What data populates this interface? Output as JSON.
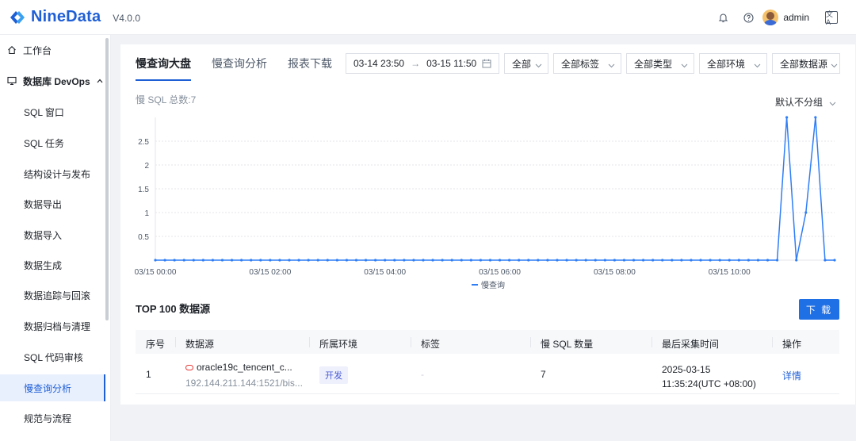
{
  "app": {
    "brand": "NineData",
    "version": "V4.0.0",
    "username": "admin",
    "lang_icon_text": "文A",
    "brand_color": "#1f5fd6"
  },
  "sidebar": {
    "items": [
      {
        "label": "工作台",
        "icon": "home-icon"
      },
      {
        "label": "数据库 DevOps",
        "icon": "monitor-icon",
        "expanded": true
      },
      {
        "label": "SQL 窗口"
      },
      {
        "label": "SQL 任务"
      },
      {
        "label": "结构设计与发布"
      },
      {
        "label": "数据导出"
      },
      {
        "label": "数据导入"
      },
      {
        "label": "数据生成"
      },
      {
        "label": "数据追踪与回滚"
      },
      {
        "label": "数据归档与清理"
      },
      {
        "label": "SQL 代码审核"
      },
      {
        "label": "慢查询分析",
        "active": true
      },
      {
        "label": "规范与流程"
      }
    ]
  },
  "tabs": [
    {
      "label": "慢查询大盘",
      "active": true
    },
    {
      "label": "慢查询分析"
    },
    {
      "label": "报表下载"
    }
  ],
  "filters": {
    "date_start": "03-14 23:50",
    "date_arrow": "→",
    "date_end": "03-15 11:50",
    "selects": [
      "全部",
      "全部标签",
      "全部类型",
      "全部环境",
      "全部数据源"
    ]
  },
  "summary": {
    "total_label": "慢 SQL 总数:7",
    "group_by": "默认不分组"
  },
  "chart_data": {
    "type": "line",
    "x": [
      "03/15 00:00",
      "03/15 00:10",
      "03/15 00:20",
      "03/15 00:30",
      "03/15 00:40",
      "03/15 00:50",
      "03/15 01:00",
      "03/15 01:10",
      "03/15 01:20",
      "03/15 01:30",
      "03/15 01:40",
      "03/15 01:50",
      "03/15 02:00",
      "03/15 02:10",
      "03/15 02:20",
      "03/15 02:30",
      "03/15 02:40",
      "03/15 02:50",
      "03/15 03:00",
      "03/15 03:10",
      "03/15 03:20",
      "03/15 03:30",
      "03/15 03:40",
      "03/15 03:50",
      "03/15 04:00",
      "03/15 04:10",
      "03/15 04:20",
      "03/15 04:30",
      "03/15 04:40",
      "03/15 04:50",
      "03/15 05:00",
      "03/15 05:10",
      "03/15 05:20",
      "03/15 05:30",
      "03/15 05:40",
      "03/15 05:50",
      "03/15 06:00",
      "03/15 06:10",
      "03/15 06:20",
      "03/15 06:30",
      "03/15 06:40",
      "03/15 06:50",
      "03/15 07:00",
      "03/15 07:10",
      "03/15 07:20",
      "03/15 07:30",
      "03/15 07:40",
      "03/15 07:50",
      "03/15 08:00",
      "03/15 08:10",
      "03/15 08:20",
      "03/15 08:30",
      "03/15 08:40",
      "03/15 08:50",
      "03/15 09:00",
      "03/15 09:10",
      "03/15 09:20",
      "03/15 09:30",
      "03/15 09:40",
      "03/15 09:50",
      "03/15 10:00",
      "03/15 10:10",
      "03/15 10:20",
      "03/15 10:30",
      "03/15 10:40",
      "03/15 10:50",
      "03/15 11:00",
      "03/15 11:10",
      "03/15 11:20",
      "03/15 11:30",
      "03/15 11:40",
      "03/15 11:50"
    ],
    "series": [
      {
        "name": "慢查询",
        "values": [
          0,
          0,
          0,
          0,
          0,
          0,
          0,
          0,
          0,
          0,
          0,
          0,
          0,
          0,
          0,
          0,
          0,
          0,
          0,
          0,
          0,
          0,
          0,
          0,
          0,
          0,
          0,
          0,
          0,
          0,
          0,
          0,
          0,
          0,
          0,
          0,
          0,
          0,
          0,
          0,
          0,
          0,
          0,
          0,
          0,
          0,
          0,
          0,
          0,
          0,
          0,
          0,
          0,
          0,
          0,
          0,
          0,
          0,
          0,
          0,
          0,
          0,
          0,
          0,
          0,
          0,
          3,
          0,
          1,
          3,
          0,
          0
        ]
      }
    ],
    "x_ticks": [
      "03/15 00:00",
      "03/15 02:00",
      "03/15 04:00",
      "03/15 06:00",
      "03/15 08:00",
      "03/15 10:00"
    ],
    "y_ticks": [
      "0.5",
      "1",
      "1.5",
      "2",
      "2.5"
    ],
    "ylim": [
      0,
      3
    ],
    "grid": true,
    "legend": "bottom-center",
    "color": "#2f7ef5"
  },
  "top_sources": {
    "title": "TOP 100 数据源",
    "download_label": "下 载",
    "columns": [
      "序号",
      "数据源",
      "所属环境",
      "标签",
      "慢 SQL 数量",
      "最后采集时间",
      "操作"
    ],
    "rows": [
      {
        "index": "1",
        "name": "oracle19c_tencent_c...",
        "address": "192.144.211.144:1521/bis...",
        "env": "开发",
        "tag": "-",
        "count": "7",
        "last_date": "2025-03-15",
        "last_time": "11:35:24(UTC +08:00)",
        "action": "详情"
      }
    ]
  }
}
